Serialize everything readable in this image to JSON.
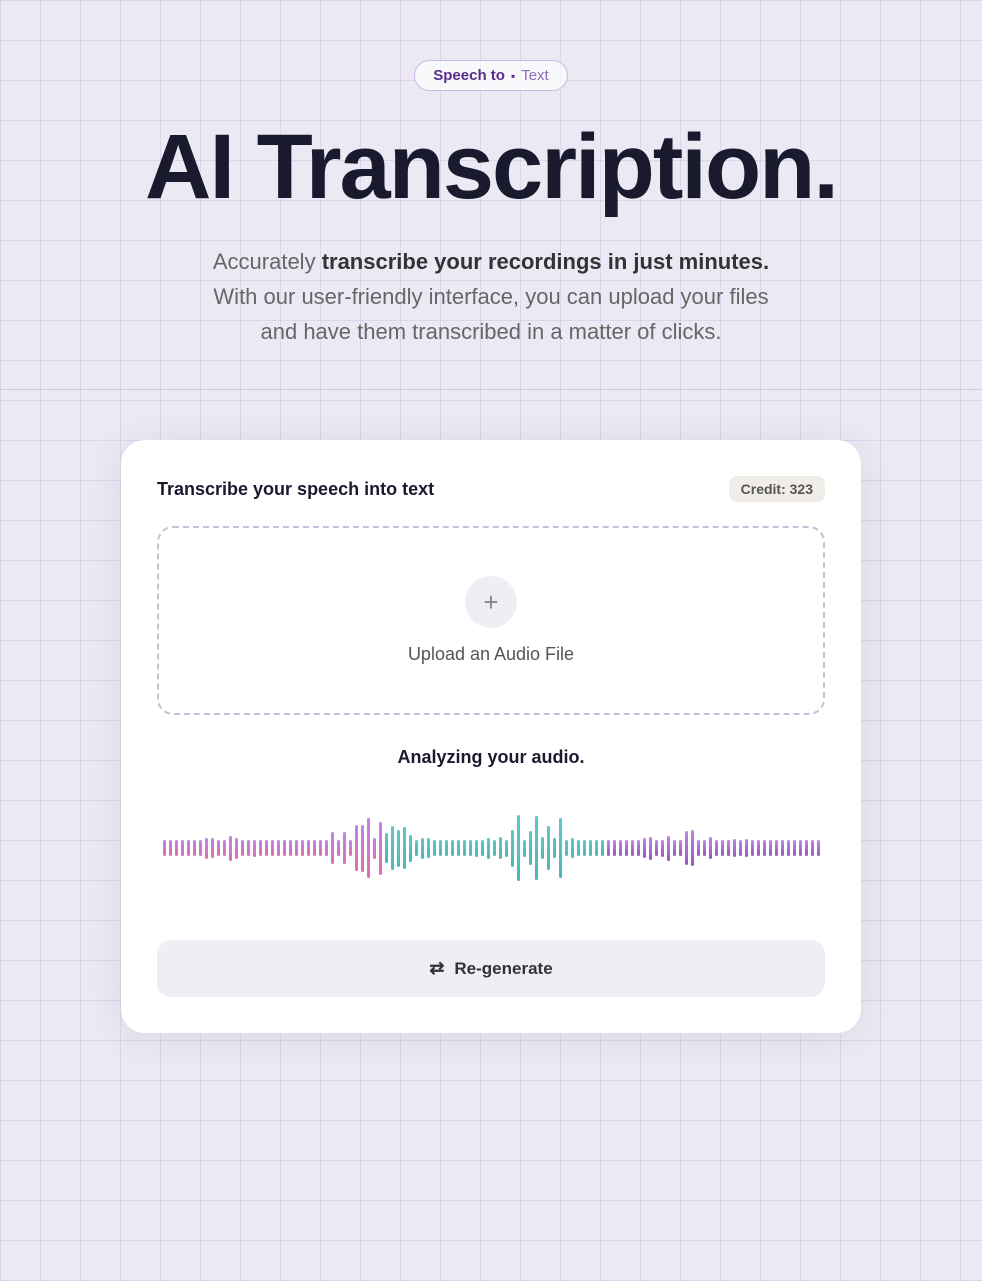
{
  "hero": {
    "badge": {
      "left": "Speech to",
      "dot": "▪",
      "right": "Text"
    },
    "title": "AI Transcription.",
    "subtitle_normal": "Accurately ",
    "subtitle_bold": "transcribe your recordings in just minutes.",
    "subtitle_rest": " With our user-friendly interface, you can upload your files and have them transcribed in a matter of clicks."
  },
  "card": {
    "title": "Transcribe your speech into text",
    "credit_label": "Credit: 323",
    "upload_label": "Upload an Audio File",
    "upload_plus": "+",
    "analyzing_text": "Analyzing your audio.",
    "regenerate_label": "Re-generate"
  },
  "colors": {
    "bg": "#ece9f5",
    "badge_bg": "rgba(255,255,255,0.7)",
    "badge_border": "#c9b8e8",
    "badge_left_color": "#5a2d8c",
    "badge_right_color": "#8b6bbf",
    "title_color": "#1a1a2e",
    "accent_purple": "#7c4dbb",
    "waveform_purple": "#c084e8",
    "waveform_teal": "#5ec8c8",
    "waveform_pink": "#e06cb0"
  }
}
